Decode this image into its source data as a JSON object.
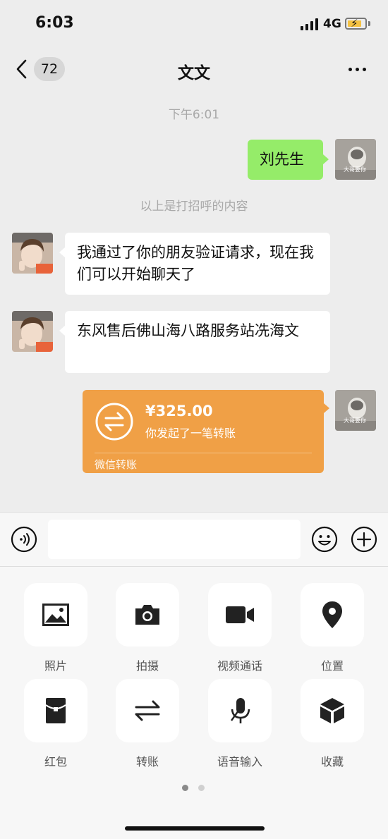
{
  "status_bar": {
    "time": "6:03",
    "network": "4G"
  },
  "header": {
    "unread_count": "72",
    "title": "文文"
  },
  "chat": {
    "timestamp": "下午6:01",
    "greeting_note": "以上是打招呼的内容",
    "messages": [
      {
        "from": "me",
        "text": "刘先生"
      },
      {
        "from": "friend",
        "text": "我通过了你的朋友验证请求，现在我们可以开始聊天了"
      },
      {
        "from": "friend",
        "text": "东风售后佛山海八路服务站冼海文"
      }
    ],
    "transfer": {
      "amount": "¥325.00",
      "description": "你发起了一笔转账",
      "footer": "微信转账"
    },
    "self_avatar_tag": "大哥要你"
  },
  "input_bar": {
    "value": ""
  },
  "panel": {
    "items": [
      {
        "label": "照片",
        "icon": "photo-icon"
      },
      {
        "label": "拍摄",
        "icon": "camera-icon"
      },
      {
        "label": "视频通话",
        "icon": "video-call-icon"
      },
      {
        "label": "位置",
        "icon": "location-icon"
      },
      {
        "label": "红包",
        "icon": "red-packet-icon"
      },
      {
        "label": "转账",
        "icon": "transfer-icon"
      },
      {
        "label": "语音输入",
        "icon": "microphone-icon"
      },
      {
        "label": "收藏",
        "icon": "favorites-icon"
      }
    ],
    "page": 1,
    "page_count": 2
  },
  "colors": {
    "chat_bg": "#ededed",
    "my_bubble": "#95ec69",
    "friend_bubble": "#ffffff",
    "transfer_card": "#f0a046",
    "battery": "#f5c242"
  }
}
